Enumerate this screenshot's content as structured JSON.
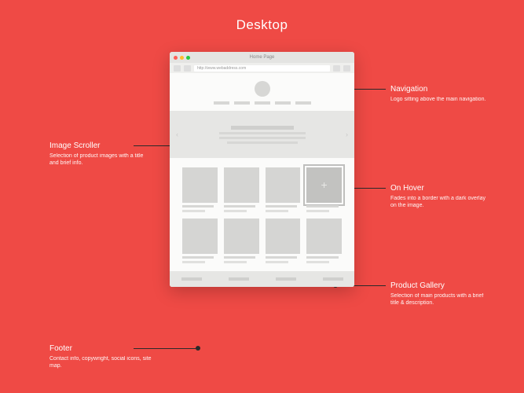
{
  "title": "Desktop",
  "browser": {
    "tab_title": "Home Page",
    "url": "http://www.webaddress.com"
  },
  "annotations": {
    "image_scroller": {
      "title": "Image Scroller",
      "desc": "Selection of product images with a title and brief info."
    },
    "footer": {
      "title": "Footer",
      "desc": "Contact info, copywright, social icons, site map."
    },
    "navigation": {
      "title": "Navigation",
      "desc": "Logo sitting above the main navigation."
    },
    "on_hover": {
      "title": "On Hover",
      "desc": "Fades into a border with a dark overlay on the image."
    },
    "product_gallery": {
      "title": "Product Gallery",
      "desc": "Selection of main products with a brief title & description."
    }
  },
  "icons": {
    "plus": "+",
    "chev_left": "‹",
    "chev_right": "›"
  }
}
